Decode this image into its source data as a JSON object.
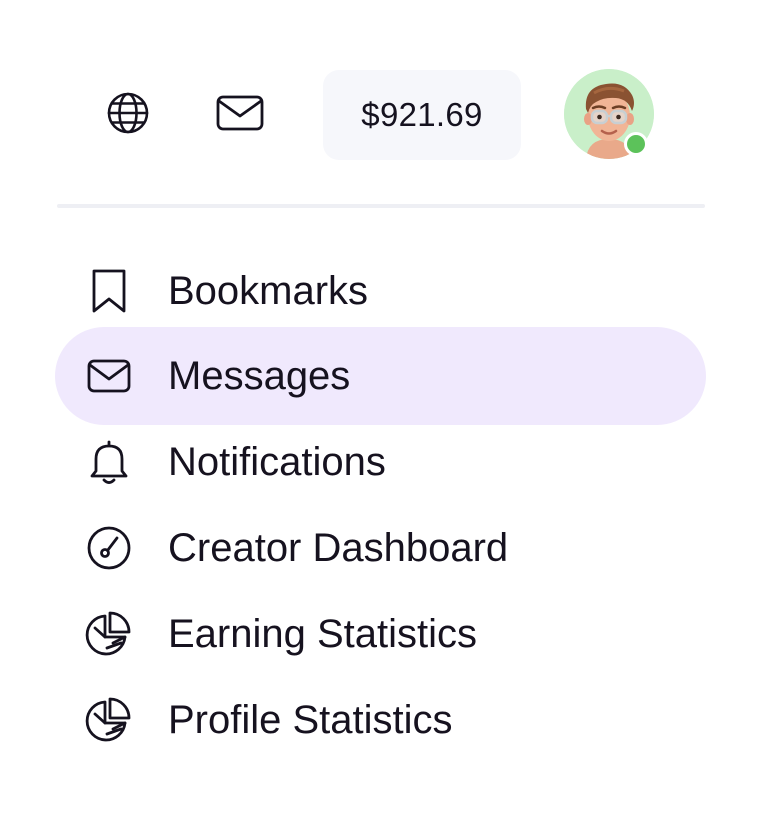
{
  "header": {
    "globe_icon": "globe-icon",
    "mail_icon": "mail-icon",
    "balance": "$921.69",
    "avatar_icon": "avatar",
    "online_color": "#5cc25a"
  },
  "menu": {
    "active_color": "#f0e9fd",
    "items": [
      {
        "label": "Bookmarks",
        "icon": "bookmark-icon",
        "active": false
      },
      {
        "label": "Messages",
        "icon": "mail-icon",
        "active": true
      },
      {
        "label": "Notifications",
        "icon": "bell-icon",
        "active": false
      },
      {
        "label": "Creator Dashboard",
        "icon": "gauge-icon",
        "active": false
      },
      {
        "label": "Earning Statistics",
        "icon": "pie-chart-icon",
        "active": false
      },
      {
        "label": "Profile Statistics",
        "icon": "pie-chart-icon",
        "active": false
      }
    ]
  }
}
